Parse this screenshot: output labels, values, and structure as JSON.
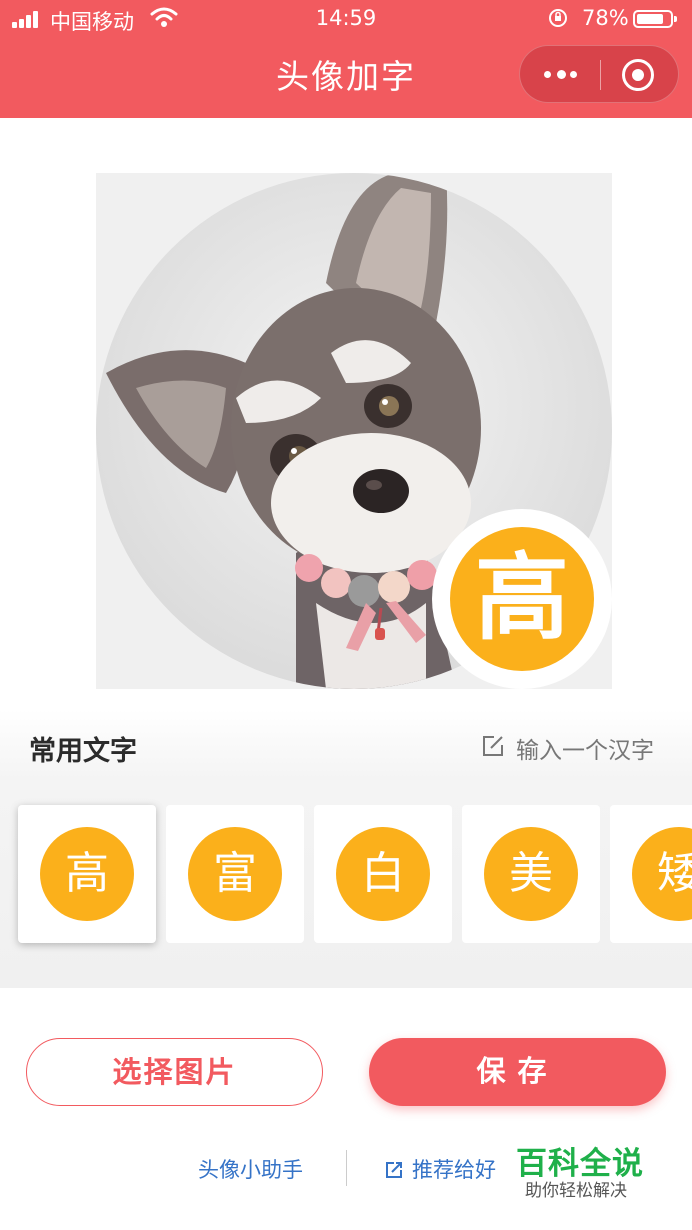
{
  "status_bar": {
    "carrier": "中国移动",
    "time": "14:59",
    "battery": "78%",
    "battery_level": 0.78
  },
  "nav": {
    "title": "头像加字",
    "more_icon": "more-dots-icon",
    "close_icon": "target-close-icon"
  },
  "preview": {
    "badge_char": "高",
    "image": "schnauzer-puppy-photo"
  },
  "common_text": {
    "title": "常用文字",
    "input_label": "输入一个汉字",
    "chars": [
      "高",
      "富",
      "白",
      "美",
      "矮"
    ],
    "selected_index": 0
  },
  "actions": {
    "select_image": "选择图片",
    "save": "保存"
  },
  "footer": {
    "helper_link": "头像小助手",
    "share_link": "推荐给好友"
  },
  "watermark": {
    "title": "百科全说",
    "subtitle": "助你轻松解决"
  },
  "colors": {
    "brand": "#f25a5f",
    "badge": "#fbb01b",
    "link": "#3573c7",
    "watermark": "#1fb04a"
  }
}
